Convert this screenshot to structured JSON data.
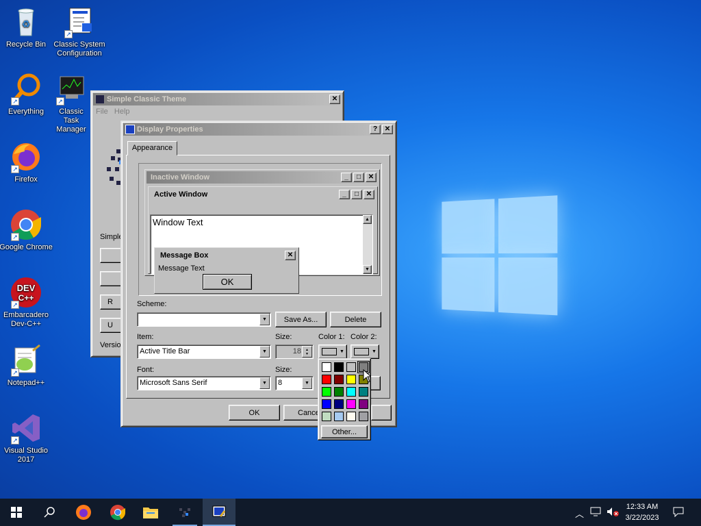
{
  "desktop": {
    "icons": [
      {
        "label": "Recycle Bin",
        "icon": "recycle-bin-icon"
      },
      {
        "label": "Classic System Configuration",
        "icon": "system-config-icon"
      },
      {
        "label": "Everything",
        "icon": "everything-search-icon"
      },
      {
        "label": "Classic Task Manager",
        "icon": "task-manager-icon"
      },
      {
        "label": "Firefox",
        "icon": "firefox-icon"
      },
      {
        "label": "Google Chrome",
        "icon": "chrome-icon"
      },
      {
        "label": "Embarcadero Dev-C++",
        "icon": "devcpp-icon"
      },
      {
        "label": "Notepad++",
        "icon": "notepadpp-icon"
      },
      {
        "label": "Visual Studio 2017",
        "icon": "visual-studio-icon"
      }
    ]
  },
  "sct_window": {
    "title": "Simple Classic Theme",
    "menu": [
      "File",
      "Help"
    ],
    "partial_labels": {
      "simple": "Simple",
      "version": "Version",
      "btn_r": "R",
      "btn_u": "U"
    },
    "close": "✕"
  },
  "display_props": {
    "title": "Display Properties",
    "help": "?",
    "close": "✕",
    "tab": "Appearance",
    "preview": {
      "inactive_title": "Inactive Window",
      "active_title": "Active Window",
      "window_text": "Window Text",
      "msgbox_title": "Message Box",
      "msgbox_text": "Message Text",
      "ok": "OK"
    },
    "scheme_label": "Scheme:",
    "scheme_value": "",
    "save_as": "Save As...",
    "delete": "Delete",
    "item_label": "Item:",
    "item_value": "Active Title Bar",
    "item_size_label": "Size:",
    "item_size_value": "18",
    "color1_label": "Color 1:",
    "color2_label": "Color 2:",
    "font_label": "Font:",
    "font_value": "Microsoft Sans Serif",
    "font_size_label": "Size:",
    "font_size_value": "8",
    "ok": "OK",
    "cancel": "Cance",
    "other": "Other..."
  },
  "palette": [
    "#ffffff",
    "#000000",
    "#c0c0c0",
    "#808080",
    "#ff0000",
    "#800000",
    "#ffff00",
    "#808000",
    "#00ff00",
    "#008000",
    "#00ffff",
    "#008080",
    "#0000ff",
    "#000080",
    "#ff00ff",
    "#800080",
    "#c0dcc0",
    "#a6caf0",
    "#fffbf0",
    "#a0a0a4"
  ],
  "taskbar": {
    "items": [
      "start-icon",
      "search-icon",
      "firefox-icon",
      "chrome-icon",
      "file-explorer-icon",
      "task-manager-icon",
      "display-properties-icon"
    ],
    "time": "12:33 AM",
    "date": "3/22/2023"
  }
}
